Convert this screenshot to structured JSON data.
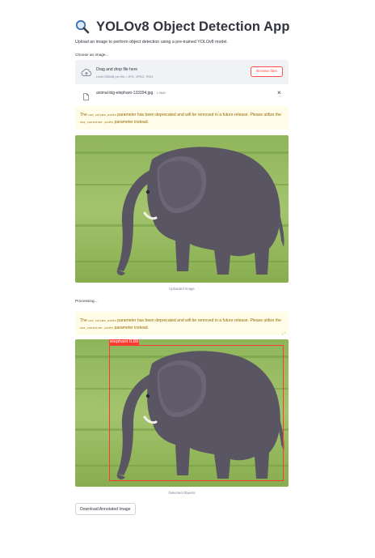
{
  "header": {
    "title": "YOLOv8 Object Detection App",
    "subtitle": "Upload an image to perform object detection using a pre-trained YOLOv8 model.",
    "title_icon": "magnifying-glass-icon"
  },
  "uploader": {
    "label": "Choose an image...",
    "drop_title": "Drag and drop file here",
    "limit_text": "Limit 200MB per file • JPG, JPEG, PNG",
    "browse_label": "Browse files",
    "icon": "cloud-upload-icon"
  },
  "file": {
    "name": "animal-big-elephant-133394.jpg",
    "size": "1.5MB",
    "close_symbol": "×"
  },
  "warnings": [
    {
      "pre": "The ",
      "code1": "use_column_width",
      "mid": " parameter has been deprecated and will be removed in a future release. Please utilize the ",
      "code2": "use_container_width",
      "post": " parameter instead."
    },
    {
      "pre": "The ",
      "code1": "use_column_width",
      "mid": " parameter has been deprecated and will be removed in a future release. Please utilize the ",
      "code2": "use_container_width",
      "post": " parameter instead."
    }
  ],
  "uploaded": {
    "caption": "Uploaded Image"
  },
  "status": {
    "processing": "Processing..."
  },
  "detected": {
    "caption": "Detected Objects",
    "label": "elephant 0.89",
    "box_color": "#ff3a2e"
  },
  "download": {
    "label": "Download Annotated Image"
  },
  "colors": {
    "accent": "#ff4b4b",
    "warning_bg": "#fffce7",
    "warning_text": "#926c05",
    "dropzone_bg": "#f0f2f6"
  }
}
